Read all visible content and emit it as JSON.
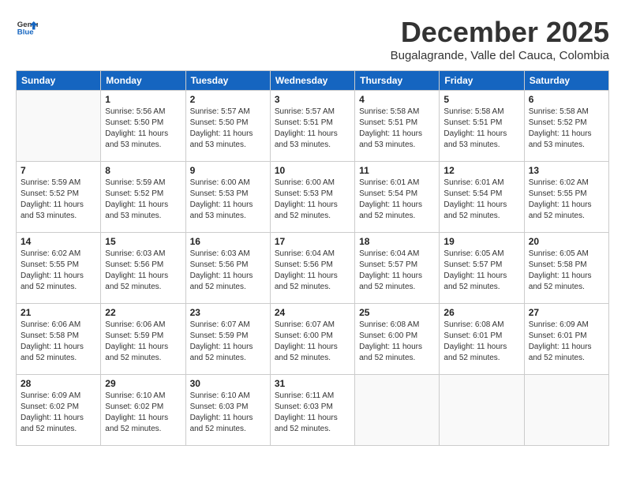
{
  "logo": {
    "general": "General",
    "blue": "Blue"
  },
  "title": "December 2025",
  "subtitle": "Bugalagrande, Valle del Cauca, Colombia",
  "days_of_week": [
    "Sunday",
    "Monday",
    "Tuesday",
    "Wednesday",
    "Thursday",
    "Friday",
    "Saturday"
  ],
  "weeks": [
    [
      {
        "day": "",
        "info": ""
      },
      {
        "day": "1",
        "info": "Sunrise: 5:56 AM\nSunset: 5:50 PM\nDaylight: 11 hours\nand 53 minutes."
      },
      {
        "day": "2",
        "info": "Sunrise: 5:57 AM\nSunset: 5:50 PM\nDaylight: 11 hours\nand 53 minutes."
      },
      {
        "day": "3",
        "info": "Sunrise: 5:57 AM\nSunset: 5:51 PM\nDaylight: 11 hours\nand 53 minutes."
      },
      {
        "day": "4",
        "info": "Sunrise: 5:58 AM\nSunset: 5:51 PM\nDaylight: 11 hours\nand 53 minutes."
      },
      {
        "day": "5",
        "info": "Sunrise: 5:58 AM\nSunset: 5:51 PM\nDaylight: 11 hours\nand 53 minutes."
      },
      {
        "day": "6",
        "info": "Sunrise: 5:58 AM\nSunset: 5:52 PM\nDaylight: 11 hours\nand 53 minutes."
      }
    ],
    [
      {
        "day": "7",
        "info": "Sunrise: 5:59 AM\nSunset: 5:52 PM\nDaylight: 11 hours\nand 53 minutes."
      },
      {
        "day": "8",
        "info": "Sunrise: 5:59 AM\nSunset: 5:52 PM\nDaylight: 11 hours\nand 53 minutes."
      },
      {
        "day": "9",
        "info": "Sunrise: 6:00 AM\nSunset: 5:53 PM\nDaylight: 11 hours\nand 53 minutes."
      },
      {
        "day": "10",
        "info": "Sunrise: 6:00 AM\nSunset: 5:53 PM\nDaylight: 11 hours\nand 52 minutes."
      },
      {
        "day": "11",
        "info": "Sunrise: 6:01 AM\nSunset: 5:54 PM\nDaylight: 11 hours\nand 52 minutes."
      },
      {
        "day": "12",
        "info": "Sunrise: 6:01 AM\nSunset: 5:54 PM\nDaylight: 11 hours\nand 52 minutes."
      },
      {
        "day": "13",
        "info": "Sunrise: 6:02 AM\nSunset: 5:55 PM\nDaylight: 11 hours\nand 52 minutes."
      }
    ],
    [
      {
        "day": "14",
        "info": "Sunrise: 6:02 AM\nSunset: 5:55 PM\nDaylight: 11 hours\nand 52 minutes."
      },
      {
        "day": "15",
        "info": "Sunrise: 6:03 AM\nSunset: 5:56 PM\nDaylight: 11 hours\nand 52 minutes."
      },
      {
        "day": "16",
        "info": "Sunrise: 6:03 AM\nSunset: 5:56 PM\nDaylight: 11 hours\nand 52 minutes."
      },
      {
        "day": "17",
        "info": "Sunrise: 6:04 AM\nSunset: 5:56 PM\nDaylight: 11 hours\nand 52 minutes."
      },
      {
        "day": "18",
        "info": "Sunrise: 6:04 AM\nSunset: 5:57 PM\nDaylight: 11 hours\nand 52 minutes."
      },
      {
        "day": "19",
        "info": "Sunrise: 6:05 AM\nSunset: 5:57 PM\nDaylight: 11 hours\nand 52 minutes."
      },
      {
        "day": "20",
        "info": "Sunrise: 6:05 AM\nSunset: 5:58 PM\nDaylight: 11 hours\nand 52 minutes."
      }
    ],
    [
      {
        "day": "21",
        "info": "Sunrise: 6:06 AM\nSunset: 5:58 PM\nDaylight: 11 hours\nand 52 minutes."
      },
      {
        "day": "22",
        "info": "Sunrise: 6:06 AM\nSunset: 5:59 PM\nDaylight: 11 hours\nand 52 minutes."
      },
      {
        "day": "23",
        "info": "Sunrise: 6:07 AM\nSunset: 5:59 PM\nDaylight: 11 hours\nand 52 minutes."
      },
      {
        "day": "24",
        "info": "Sunrise: 6:07 AM\nSunset: 6:00 PM\nDaylight: 11 hours\nand 52 minutes."
      },
      {
        "day": "25",
        "info": "Sunrise: 6:08 AM\nSunset: 6:00 PM\nDaylight: 11 hours\nand 52 minutes."
      },
      {
        "day": "26",
        "info": "Sunrise: 6:08 AM\nSunset: 6:01 PM\nDaylight: 11 hours\nand 52 minutes."
      },
      {
        "day": "27",
        "info": "Sunrise: 6:09 AM\nSunset: 6:01 PM\nDaylight: 11 hours\nand 52 minutes."
      }
    ],
    [
      {
        "day": "28",
        "info": "Sunrise: 6:09 AM\nSunset: 6:02 PM\nDaylight: 11 hours\nand 52 minutes."
      },
      {
        "day": "29",
        "info": "Sunrise: 6:10 AM\nSunset: 6:02 PM\nDaylight: 11 hours\nand 52 minutes."
      },
      {
        "day": "30",
        "info": "Sunrise: 6:10 AM\nSunset: 6:03 PM\nDaylight: 11 hours\nand 52 minutes."
      },
      {
        "day": "31",
        "info": "Sunrise: 6:11 AM\nSunset: 6:03 PM\nDaylight: 11 hours\nand 52 minutes."
      },
      {
        "day": "",
        "info": ""
      },
      {
        "day": "",
        "info": ""
      },
      {
        "day": "",
        "info": ""
      }
    ]
  ]
}
